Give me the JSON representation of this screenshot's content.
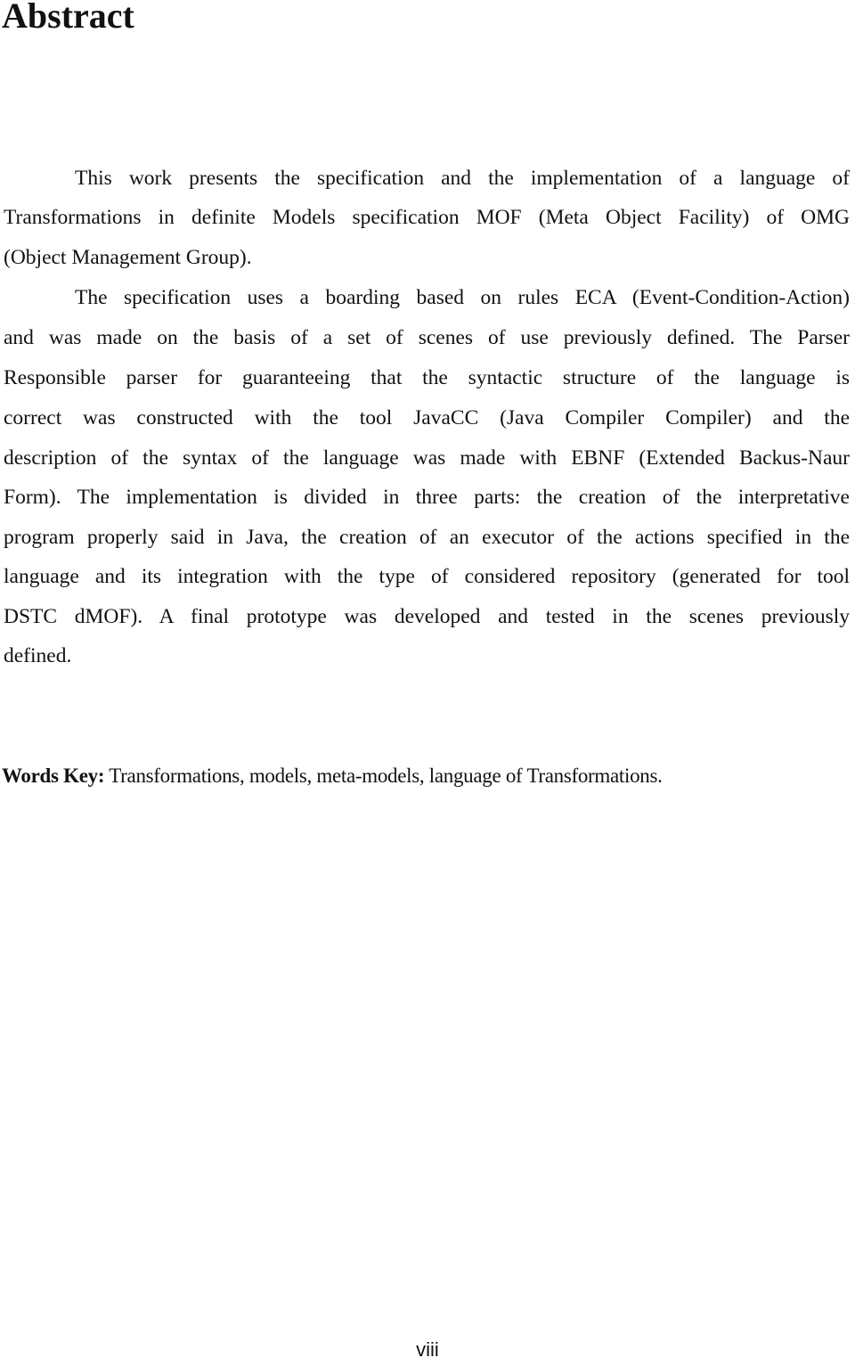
{
  "document": {
    "title": "Abstract",
    "lines": [
      "This work presents the specification and the implementation of a language of",
      "Transformations in definite Models specification MOF (Meta Object Facility) of OMG",
      "(Object Management Group).",
      "The specification uses a boarding based on rules ECA (Event-Condition-Action)",
      "and was made on the basis of a set of scenes of use previously defined. The Parser",
      "Responsible parser for guaranteeing that  the syntactic structure of the language is",
      "correct was constructed with the tool JavaCC (Java Compiler Compiler) and the",
      "description of the syntax of the language was made with EBNF (Extended Backus-Naur",
      "Form). The implementation is divided in three parts: the creation of the interpretative",
      "program properly said in Java, the creation of an executor of the actions specified in the",
      "language and its integration with the type of considered repository (generated for tool",
      "DSTC dMOF). A final prototype was developed and tested in  the scenes previously",
      "defined."
    ],
    "keywords": {
      "label": "Words Key:",
      "text": " Transformations, models, meta-models, language of Transformations."
    },
    "page_number": "viii"
  }
}
